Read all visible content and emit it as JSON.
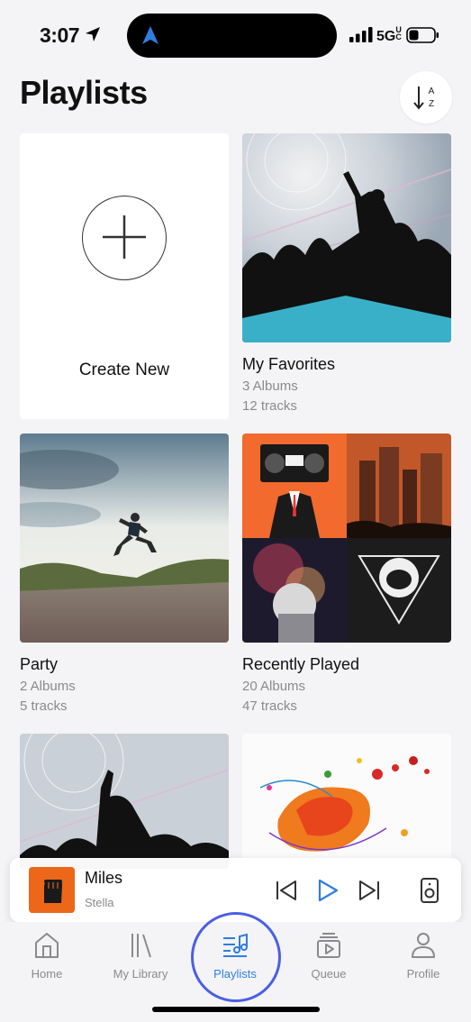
{
  "status_bar": {
    "time": "3:07",
    "network": "5G",
    "network_suffix": "UC"
  },
  "header": {
    "title": "Playlists",
    "sort_icon": "sort-az-icon",
    "sort_letters": [
      "A",
      "Z"
    ]
  },
  "create_new": {
    "label": "Create New"
  },
  "playlists": [
    {
      "name": "My Favorites",
      "albums": "3 Albums",
      "tracks": "12 tracks"
    },
    {
      "name": "Party",
      "albums": "2 Albums",
      "tracks": "5 tracks"
    },
    {
      "name": "Recently Played",
      "albums": "20 Albums",
      "tracks": "47 tracks"
    }
  ],
  "now_playing": {
    "title": "Miles",
    "artist": "Stella"
  },
  "tabs": [
    {
      "label": "Home",
      "icon": "home-icon"
    },
    {
      "label": "My Library",
      "icon": "library-icon"
    },
    {
      "label": "Playlists",
      "icon": "playlists-icon",
      "active": true
    },
    {
      "label": "Queue",
      "icon": "queue-icon"
    },
    {
      "label": "Profile",
      "icon": "profile-icon"
    }
  ],
  "colors": {
    "accent": "#2f7de1",
    "ring": "#4a5fe6",
    "background": "#f4f4f6"
  }
}
